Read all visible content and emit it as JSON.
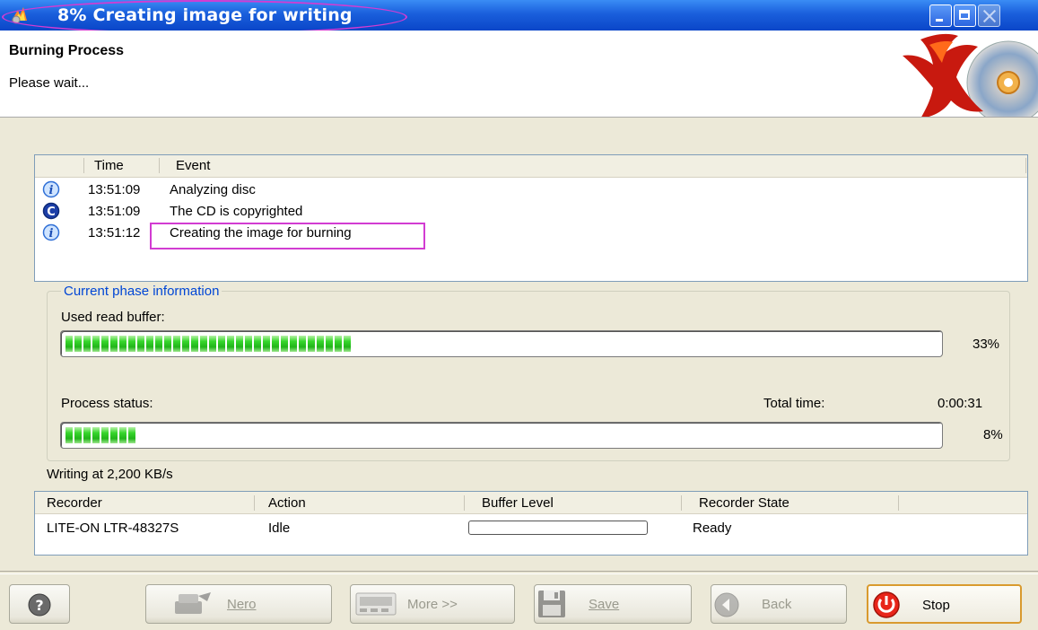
{
  "window": {
    "title": "8% Creating image for writing",
    "icon": "nero-flame-icon",
    "controls": [
      "minimize",
      "maximize",
      "close"
    ]
  },
  "header": {
    "title": "Burning Process",
    "subtitle": "Please wait...",
    "logo": "nero-x-disc-logo"
  },
  "event_log": {
    "columns": [
      "Time",
      "Event"
    ],
    "rows": [
      {
        "icon": "info-icon",
        "time": "13:51:09",
        "event": "Analyzing disc"
      },
      {
        "icon": "copyright-icon",
        "time": "13:51:09",
        "event": "The CD is copyrighted"
      },
      {
        "icon": "info-icon",
        "time": "13:51:12",
        "event": "Creating the image for burning"
      }
    ]
  },
  "phase": {
    "group_label": "Current phase information",
    "read_buffer_label": "Used read buffer:",
    "read_buffer_percent": "33%",
    "read_buffer_fraction": 0.33,
    "process_status_label": "Process status:",
    "total_time_label": "Total time:",
    "total_time": "0:00:31",
    "process_percent": "8%",
    "process_fraction": 0.08
  },
  "writing_speed": "Writing at 2,200 KB/s",
  "recorders": {
    "columns": [
      "Recorder",
      "Action",
      "Buffer Level",
      "Recorder State"
    ],
    "rows": [
      {
        "recorder": "LITE-ON LTR-48327S",
        "action": "Idle",
        "buffer_level": 0,
        "state": "Ready"
      }
    ]
  },
  "buttons": {
    "help": "?",
    "nero": "Nero",
    "more": "More >>",
    "save": "Save",
    "back": "Back",
    "stop": "Stop"
  },
  "colors": {
    "titlebar": "#0a46c8",
    "progress_green": "#21b51a",
    "annotation_magenta": "#d23cd2",
    "group_label": "#0046d5",
    "stop_border": "#d99a2e"
  }
}
